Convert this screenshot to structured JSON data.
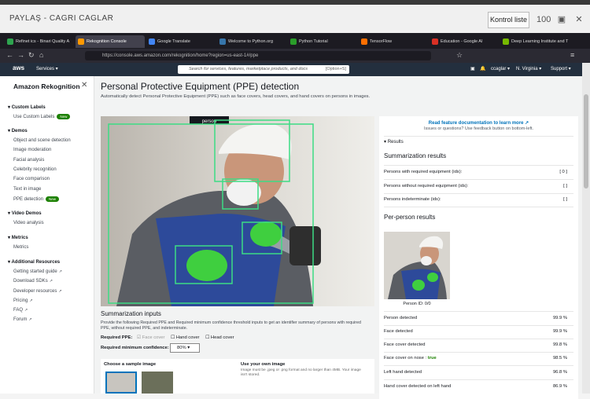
{
  "share_bar": {
    "title": "PAYLAŞ - CAGRI CAGLAR",
    "list_button": "Kontrol liste",
    "zoom_icon": "100"
  },
  "tabs": [
    {
      "label": "Refinet ics - Binari Quality A",
      "color": "#2ea44f"
    },
    {
      "label": "Rekognition Console",
      "color": "#ff9900",
      "active": true
    },
    {
      "label": "Google Translate",
      "color": "#4285f4"
    },
    {
      "label": "Welcome to Python.org",
      "color": "#3776ab"
    },
    {
      "label": "Python Tutorial",
      "color": "#2a9d2a"
    },
    {
      "label": "TensorFlow",
      "color": "#ff6f00"
    },
    {
      "label": "Education - Google AI",
      "color": "#d93025"
    },
    {
      "label": "Deep Learning Institute and T",
      "color": "#76b900"
    }
  ],
  "url": "https://console.aws.amazon.com/rekognition/home?region=us-east-1#/ppe",
  "aws": {
    "logo": "aws",
    "services": "Services ▾",
    "search_placeholder": "Search for services, features, marketplace products, and docs",
    "search_shortcut": "[Option+S]",
    "user": "ccaglar ▾",
    "region": "N. Virginia ▾",
    "support": "Support ▾"
  },
  "sidebar": {
    "title": "Amazon Rekognition",
    "custom_labels": "Custom Labels",
    "use_custom_labels": "Use Custom Labels",
    "new_badge": "New",
    "demos": "Demos",
    "demo_items": [
      "Object and scene detection",
      "Image moderation",
      "Facial analysis",
      "Celebrity recognition",
      "Face comparison",
      "Text in image",
      "PPE detection"
    ],
    "video_demos": "Video Demos",
    "video_analysis": "Video analysis",
    "metrics": "Metrics",
    "metrics_item": "Metrics",
    "additional": "Additional Resources",
    "resources": [
      "Getting started guide",
      "Download SDKs",
      "Developer resources",
      "Pricing",
      "FAQ",
      "Forum"
    ]
  },
  "main": {
    "title": "Personal Protective Equipment (PPE) detection",
    "subtitle": "Automatically detect Personal Protective Equipment (PPE) such as face covers, head covers, and hand covers on persons in images.",
    "person_label": "person"
  },
  "results": {
    "doc_link": "Read feature documentation to learn more",
    "feedback": "Issues or questions? Use feedback button on bottom-left.",
    "results_toggle": "Results",
    "summarization_title": "Summarization results",
    "summary": [
      {
        "label": "Persons with required equipment (ids):",
        "value": "[ 0 ]"
      },
      {
        "label": "Persons without required equipment (ids):",
        "value": "[ ]"
      },
      {
        "label": "Persons indeterminate (ids):",
        "value": "[ ]"
      }
    ],
    "per_person_title": "Per-person results",
    "person_id": "Person ID: 0/0",
    "detections": [
      {
        "label": "Person detected",
        "value": "99.9 %"
      },
      {
        "label": "Face detected",
        "value": "99.9 %"
      },
      {
        "label": "Face cover detected",
        "value": "99.8 %"
      },
      {
        "label": "Face cover on nose :",
        "extra": "true",
        "value": "98.5 %"
      },
      {
        "label": "Left hand detected",
        "value": "96.8 %"
      },
      {
        "label": "Hand cover detected on left hand",
        "value": "86.9 %"
      }
    ]
  },
  "inputs": {
    "title": "Summarization inputs",
    "description": "Provide the following Required PPE and Required minimum confidence threshold inputs to get an identifier summary of persons with required PPE, without required PPE, and indeterminate.",
    "required_ppe": "Required PPE:",
    "face_cover": "Face cover",
    "hand_cover": "Hand cover",
    "head_cover": "Head cover",
    "confidence_label": "Required minimum confidence:",
    "confidence_value": "80%",
    "choose_sample": "Choose a sample image",
    "use_own": "Use your own image",
    "own_desc": "Image must be .jpeg or .png format and no larger than 4MB. Your image isn't stored."
  },
  "colors": {
    "box": "#3ddc84",
    "aws_dark": "#232f3e",
    "new_green": "#1d8102",
    "link": "#0073bb"
  }
}
